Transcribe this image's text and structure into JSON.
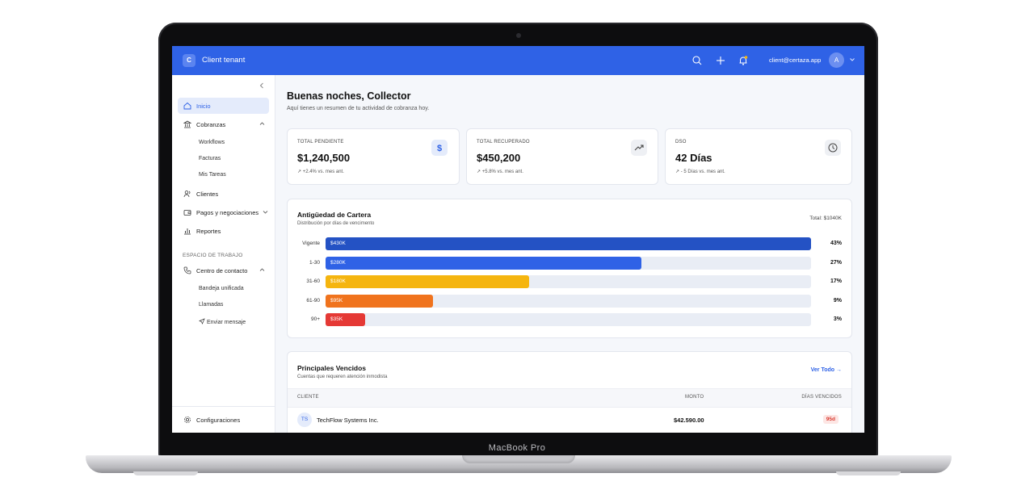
{
  "device": {
    "label": "MacBook Pro"
  },
  "topbar": {
    "brand_initial": "C",
    "brand_name": "Client tenant",
    "user_email": "client@certaza.app",
    "avatar_initial": "A",
    "icons": [
      "search-icon",
      "plus-icon",
      "bell-icon",
      "chevron-down-icon"
    ],
    "accent": "#2f62e6"
  },
  "sidebar": {
    "items": [
      {
        "label": "Inicio",
        "icon": "home-icon",
        "active": true
      },
      {
        "label": "Cobranzas",
        "icon": "bank-icon",
        "expanded": true,
        "children": [
          "Workflows",
          "Facturas",
          "Mis Tareas"
        ]
      },
      {
        "label": "Clientes",
        "icon": "users-icon"
      },
      {
        "label": "Pagos y negociaciones",
        "icon": "wallet-icon",
        "collapsed": true
      },
      {
        "label": "Reportes",
        "icon": "bar-chart-icon"
      }
    ],
    "section_label": "ESPACIO DE TRABAJO",
    "workspace": {
      "label": "Centro de contacto",
      "icon": "phone-icon",
      "expanded": true,
      "children": [
        "Bandeja unificada",
        "Llamadas",
        "Enviar mensaje"
      ]
    },
    "footer": {
      "label": "Configuraciones",
      "icon": "gear-icon"
    }
  },
  "main": {
    "greeting": "Buenas noches, Collector",
    "greeting_sub": "Aquí tienes un resumen de tu actividad de cobranza hoy.",
    "kpis": [
      {
        "label": "TOTAL PENDIENTE",
        "value": "$1,240,500",
        "change": "+2.4% vs. mes ant.",
        "icon": "dollar-icon",
        "icon_bg": "#e4ebfb",
        "icon_color": "#2f62e6"
      },
      {
        "label": "TOTAL RECUPERADO",
        "value": "$450,200",
        "change": "+5.8% vs. mes ant.",
        "icon": "trending-up-icon",
        "icon_bg": "#eef0f4",
        "icon_color": "#444444"
      },
      {
        "label": "DSO",
        "value": "42 Días",
        "change": "- 5 Días vs. mes ant.",
        "icon": "clock-icon",
        "icon_bg": "#eef0f4",
        "icon_color": "#444444"
      }
    ],
    "aging": {
      "title": "Antigüedad de Cartera",
      "subtitle": "Distribución por días de vencimento",
      "total": "Total: $1040K"
    },
    "overdue": {
      "title": "Principales Vencidos",
      "subtitle": "Cuentas que requeren atención inmodista",
      "view_all": "Ver Todo →",
      "columns": [
        "CLIENTE",
        "MONTO",
        "DÍAS VENCIDOS"
      ],
      "rows": [
        {
          "initials": "TS",
          "client": "TechFlow Systems Inc.",
          "amount": "$42.590.00",
          "days": "95d"
        }
      ]
    }
  },
  "chart_data": {
    "type": "bar",
    "orientation": "horizontal",
    "title": "Antigüedad de Cartera",
    "subtitle": "Distribución por días de vencimento",
    "categories": [
      "Vigente",
      "1-30",
      "31-60",
      "61-90",
      "90+"
    ],
    "values": [
      430,
      280,
      180,
      95,
      35
    ],
    "value_labels": [
      "$430K",
      "$280K",
      "$180K",
      "$95K",
      "$35K"
    ],
    "percent_labels": [
      "43%",
      "27%",
      "17%",
      "9%",
      "3%"
    ],
    "percent": [
      43,
      27,
      17,
      9,
      3
    ],
    "colors": [
      "#2452c4",
      "#2f62e6",
      "#f5b50f",
      "#f0731d",
      "#e53935"
    ],
    "xlim": [
      0,
      430
    ]
  }
}
